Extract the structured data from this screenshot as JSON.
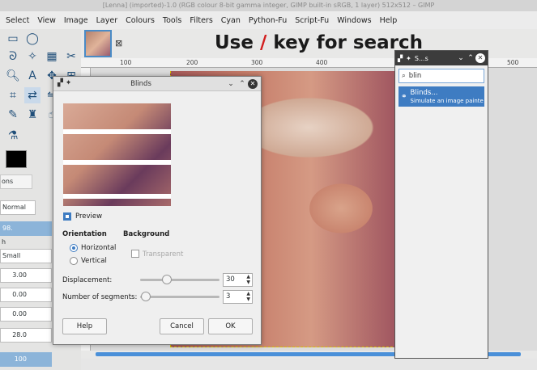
{
  "window": {
    "title": "[Lenna] (imported)-1.0 (RGB colour 8-bit gamma integer, GIMP built-in sRGB, 1 layer) 512x512 – GIMP"
  },
  "menubar": [
    "Select",
    "View",
    "Image",
    "Layer",
    "Colours",
    "Tools",
    "Filters",
    "Cyan",
    "Python-Fu",
    "Script-Fu",
    "Windows",
    "Help"
  ],
  "hint": {
    "before": "Use",
    "slash": "/",
    "after": "key for search"
  },
  "ruler": {
    "labels": [
      "100",
      "200",
      "300",
      "400",
      "500"
    ]
  },
  "toolbox": {
    "tab_label": "ons",
    "mode_value": "Normal",
    "options": [
      "98.",
      "h",
      "Small",
      "3.00",
      "0.00",
      "0.00",
      "28.0",
      "100"
    ]
  },
  "search": {
    "title": "S...s",
    "query": "blin",
    "result_name": "Blinds...",
    "result_desc": "Simulate an image painte"
  },
  "dialog": {
    "title": "Blinds",
    "preview_label": "Preview",
    "orientation_label": "Orientation",
    "horizontal_label": "Horizontal",
    "vertical_label": "Vertical",
    "background_label": "Background",
    "transparent_label": "Transparent",
    "displacement_label": "Displacement:",
    "displacement_value": "30",
    "segments_label": "Number of segments:",
    "segments_value": "3",
    "help_label": "Help",
    "cancel_label": "Cancel",
    "ok_label": "OK"
  },
  "colors": {
    "accent": "#3e7cc2",
    "hint_slash": "#d21e1e"
  }
}
